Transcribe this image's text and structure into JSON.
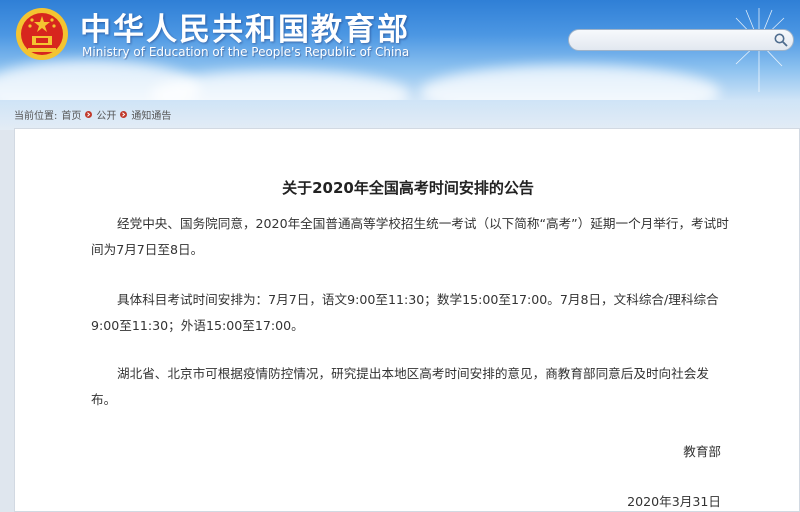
{
  "header": {
    "site_title": "中华人民共和国教育部",
    "site_subtitle": "Ministry of Education of the People's Republic of China",
    "search_placeholder": ""
  },
  "breadcrumb": {
    "label": "当前位置:",
    "items": [
      "首页",
      "公开",
      "通知通告"
    ]
  },
  "article": {
    "title": "关于2020年全国高考时间安排的公告",
    "paragraphs": [
      "经党中央、国务院同意，2020年全国普通高等学校招生统一考试（以下简称“高考”）延期一个月举行，考试时间为7月7日至8日。",
      "具体科目考试时间安排为：7月7日，语文9:00至11:30；数学15:00至17:00。7月8日，文科综合/理科综合9:00至11:30；外语15:00至17:00。",
      "湖北省、北京市可根据疫情防控情况，研究提出本地区高考时间安排的意见，商教育部同意后及时向社会发布。"
    ],
    "signature": "教育部",
    "date": "2020年3月31日"
  },
  "colors": {
    "banner_top": "#2f7fd6",
    "emblem_red": "#d7261e",
    "emblem_gold": "#f4c431"
  }
}
